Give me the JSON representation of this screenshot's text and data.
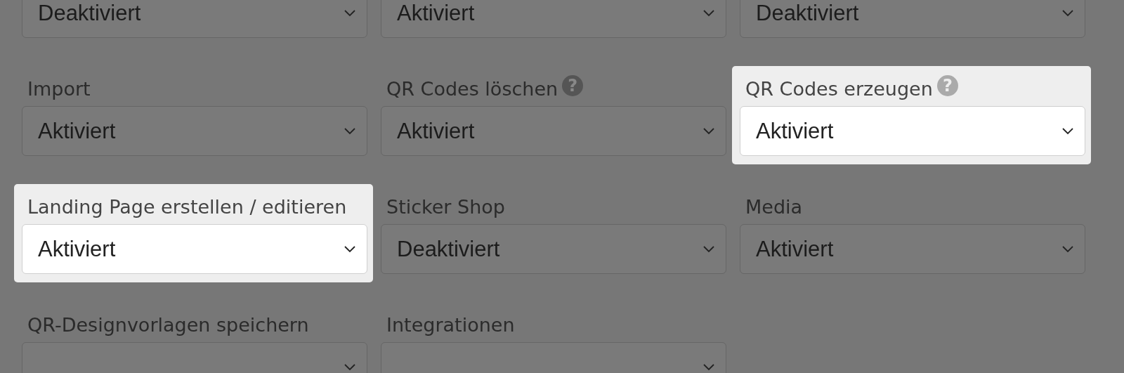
{
  "rows": [
    {
      "fields": [
        {
          "value": "Deaktiviert",
          "highlighted": false
        },
        {
          "value": "Aktiviert",
          "highlighted": false
        },
        {
          "value": "Deaktiviert",
          "highlighted": false
        }
      ]
    },
    {
      "fields": [
        {
          "label": "Import",
          "value": "Aktiviert",
          "highlighted": false
        },
        {
          "label": "QR Codes löschen",
          "help": "?",
          "value": "Aktiviert",
          "highlighted": false
        },
        {
          "label": "QR Codes erzeugen",
          "help": "?",
          "value": "Aktiviert",
          "highlighted": true
        }
      ]
    },
    {
      "fields": [
        {
          "label": "Landing Page erstellen / editieren",
          "value": "Aktiviert",
          "highlighted": true
        },
        {
          "label": "Sticker Shop",
          "value": "Deaktiviert",
          "highlighted": false
        },
        {
          "label": "Media",
          "value": "Aktiviert",
          "highlighted": false
        }
      ]
    },
    {
      "fields": [
        {
          "label": "QR-Designvorlagen speichern",
          "highlighted": false
        },
        {
          "label": "Integrationen",
          "highlighted": false
        }
      ]
    }
  ]
}
